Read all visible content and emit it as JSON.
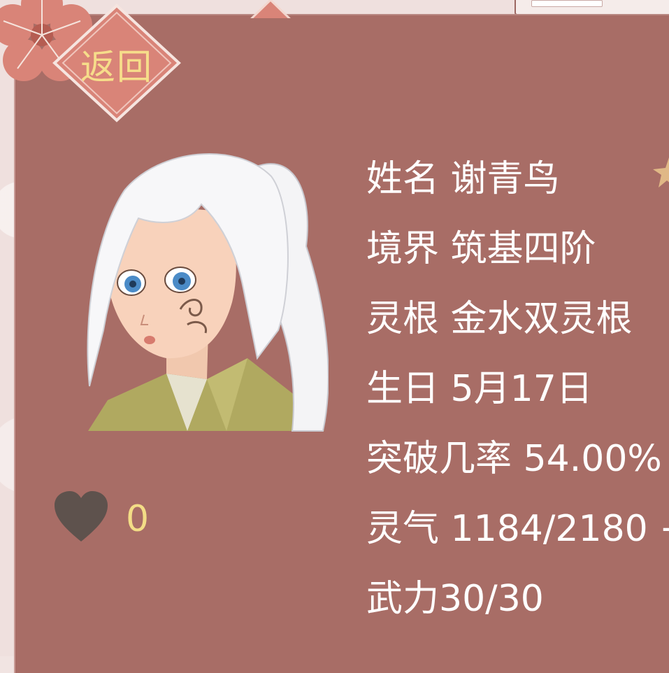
{
  "back_button": {
    "label": "返回"
  },
  "character": {
    "name_label": "姓名",
    "name": "谢青鸟",
    "realm_label": "境界",
    "realm": "筑基四阶",
    "root_label": "灵根",
    "root": "金水双灵根",
    "birthday_label": "生日",
    "birthday": "5月17日",
    "breakthrough_label": "突破几率",
    "breakthrough": "54.00%",
    "qi_label": "灵气",
    "qi": "1184/2180 +",
    "force_label": "武力",
    "force": "30/30",
    "affection": "0"
  },
  "colors": {
    "panel": "#a86d66",
    "accent_text": "#f3dd86",
    "text": "#ffffff"
  }
}
